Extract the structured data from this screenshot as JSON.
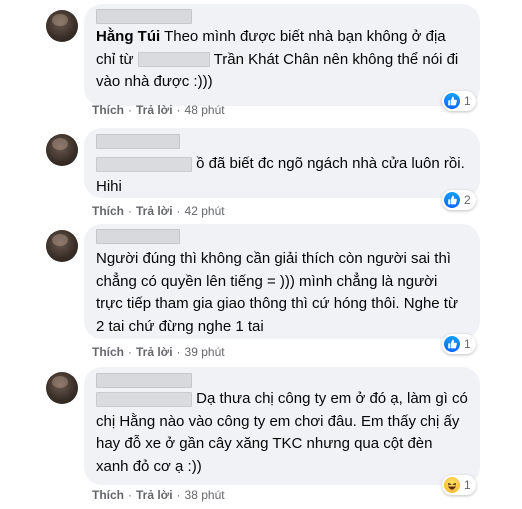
{
  "comments": [
    {
      "author": "Hằng Túi",
      "text_a": "Theo mình được biết nhà bạn không ở địa chỉ từ",
      "text_b": "Trần Khát Chân nên không thể nói đi vào nhà được :)))",
      "like": "Thích",
      "reply": "Trả lời",
      "time": "48 phút",
      "reaction_icon": "like-icon",
      "reaction_count": "1"
    },
    {
      "text": "ồ đã biết đc ngõ ngách nhà cửa luôn rồi. Hihi",
      "like": "Thích",
      "reply": "Trả lời",
      "time": "42 phút",
      "reaction_icon": "like-icon",
      "reaction_count": "2"
    },
    {
      "text": "Người đúng thì không cần giải thích còn người sai thì chẳng có quyền lên tiếng = ))) mình chẳng là người trực tiếp tham gia giao thông thì cứ hóng thôi. Nghe từ 2 tai chứ đừng nghe 1 tai",
      "like": "Thích",
      "reply": "Trả lời",
      "time": "39 phút",
      "reaction_icon": "like-icon",
      "reaction_count": "1"
    },
    {
      "text": "Dạ thưa chị công ty em ở đó ạ, làm gì có chị Hằng nào vào công ty em chơi đâu. Em thấy chị ấy hay đỗ xe ở gần cây xăng TKC nhưng qua cột đèn xanh đỏ cơ ạ :))",
      "like": "Thích",
      "reply": "Trả lời",
      "time": "38 phút",
      "reaction_icon": "haha-icon",
      "reaction_count": "1"
    }
  ],
  "colors": {
    "bubble": "#f0f2f5",
    "meta": "#65676b",
    "like_blue": "#0866ff",
    "haha_yellow": "#f7b125"
  }
}
